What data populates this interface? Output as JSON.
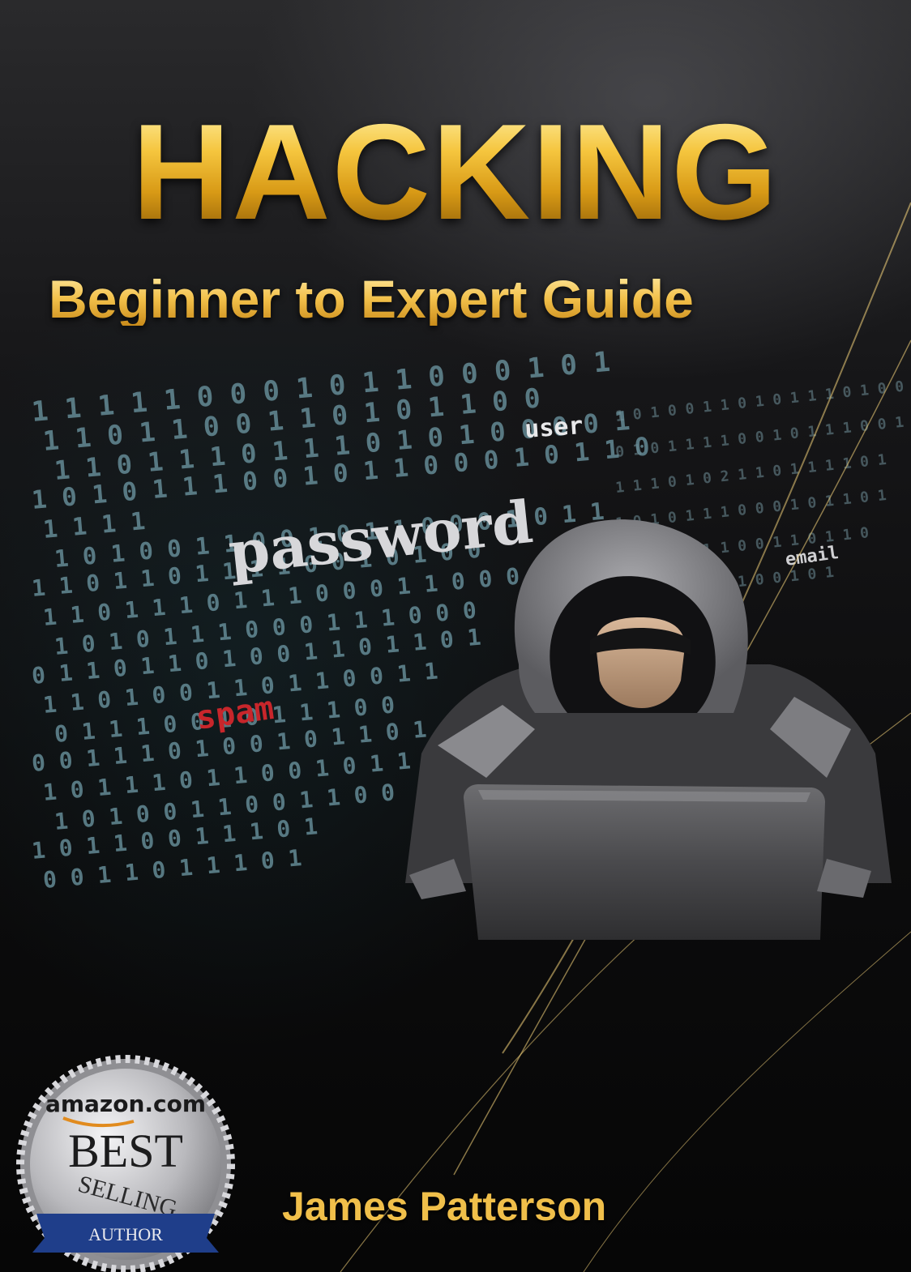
{
  "cover": {
    "title": "HACKING",
    "subtitle": "Beginner to Expert Guide",
    "author": "James Patterson"
  },
  "art": {
    "words": {
      "user": "user",
      "password": "password",
      "email": "email",
      "spam": "spam"
    },
    "binary_rows": [
      "1 1 1 1 1 0      0 0 1 0 1 1 0 0 0 1 0 1",
      "1 1 0 1 1 0 0 1 1 0   1 0 1   1 0 0",
      "1 1 0 1 1 1 0 1 1 1 0   1 0 1   0 0 0 0 1",
      "1 0 1 0 1 1 1 0 0 1 0 1 1 0 0 0 1 0 1 1 0",
      "1 1 1 1",
      "1 0 1 0 0 1 1 0 0 1 0 1 1 0 0 0 1 0 1 1",
      "1 1 0 1 1 0 1 1 1 1 0 0 1 0 1 0 0",
      "1 1 0 1 1 1 0 1 1 1 0 0 0 1 1 0 0 0 1",
      "1 0 1 0 1 1 1 0 0   0 1 1 1 0 0 0",
      "0 1 1 0 1 1 0 1 0 0 1 1 0 1 1 0 1",
      "1 1 0 1 0 0 1 1 0 1 1 0 0 1 1",
      "0 1 1 1 0 0 1 0 1 1 1 0 0",
      "0 0 1 1 1 0 1 0 0 1 0 1 1 0 1",
      "1 0 1 1 1 0 1 1 0 0 1 0 1 1",
      "1 0 1 0 0 1 1 0 0 1 1 0 0",
      "1 0 1 1 0 0 1 1 1 0 1",
      "0 0 1 1 0 1 1 1 0 1"
    ],
    "right_rows": [
      "1 0 1 0 0 1 1 0 1 0 1 1 1 0 1 0 0 1",
      "0 1 0 1   1 1 1 0 0 1 0 1 1 1 0 0 1",
      "1 1 1   0 1 0 2 1 1 0 1   1 1 1 0 1",
      "1 0 1 0 1 1 1 0 0 0 1 0 1 1 0 1",
      "1 0 1 1 0 1 1 0 0 1 1 0 1 1 0",
      "0 1 0 1 1 1 1 1 0 0 1 0 1"
    ]
  },
  "badge": {
    "brand": "amazon.com",
    "line1": "BEST",
    "line2": "SELLING",
    "line3": "AUTHOR"
  },
  "colors": {
    "gold": "#f0bf4a",
    "binary_teal": "#6f9aa6",
    "spam_red": "#c8262b",
    "silver": "#c9c9cc"
  }
}
